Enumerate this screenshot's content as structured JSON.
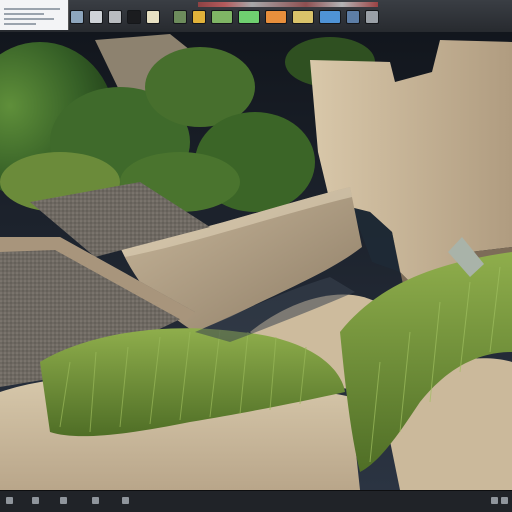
{
  "window": {
    "title": "",
    "project_label": ""
  },
  "toolbar": {
    "tools": [
      {
        "icon": "viewport-icon",
        "color": "#8ea6bd"
      },
      {
        "icon": "select-icon",
        "color": "#cfd3d8"
      },
      {
        "icon": "move-icon",
        "color": "#b9bcc0"
      },
      {
        "icon": "sphere-icon",
        "color": "#1b1c1f"
      },
      {
        "icon": "light-icon",
        "color": "#e7e0c2"
      },
      {
        "icon": "terrain-icon",
        "color": "#6d8c5c"
      },
      {
        "icon": "foliage-icon",
        "color": "#e1b23a"
      },
      {
        "icon": "landscape-thumb-icon",
        "color": "#7fb565"
      },
      {
        "icon": "foliage-thumb-icon",
        "color": "#6fd070"
      },
      {
        "icon": "material-thumb-icon",
        "color": "#e88f3c"
      },
      {
        "icon": "sand-thumb-icon",
        "color": "#d9c36a"
      },
      {
        "icon": "sky-thumb-icon",
        "color": "#4f93d6"
      },
      {
        "icon": "water-icon",
        "color": "#5d7ea6"
      },
      {
        "icon": "settings-icon",
        "color": "#9aa0a7"
      }
    ]
  },
  "viewport": {
    "scene_colors": {
      "sky": "#1c2634",
      "foliage": "#3f6f2e",
      "stone": "#b8a890",
      "sand": "#d2c3a6",
      "grass": "#6f8c3a"
    }
  },
  "statusbar": {
    "items": [
      "",
      "",
      "",
      "",
      "",
      ""
    ]
  }
}
